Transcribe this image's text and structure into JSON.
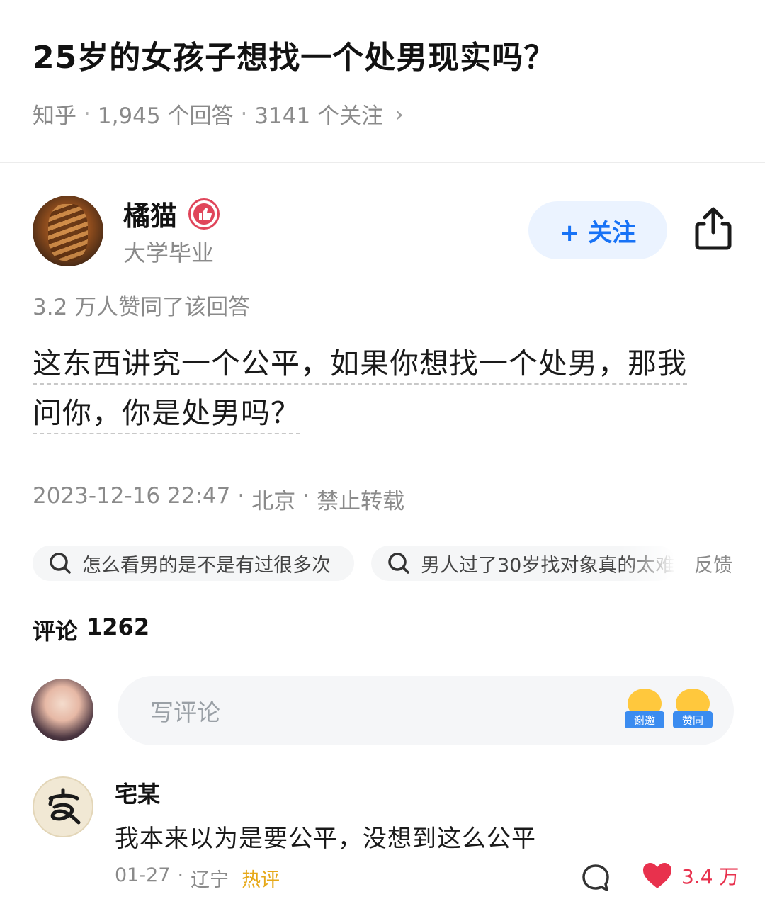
{
  "question": {
    "title": "25岁的女孩子想找一个处男现实吗？",
    "source": "知乎",
    "answers_count": "1,945 个回答",
    "followers_count": "3141 个关注",
    "sep": "·",
    "chevron": "›"
  },
  "author": {
    "name": "橘猫",
    "bio": "大学毕业",
    "follow_label": "+ 关注",
    "avatar_icon": "cat-fur-avatar",
    "badge_icon": "thumbs-up-badge-icon"
  },
  "answer": {
    "upvotes": "3.2 万人赞同了该回答",
    "line1": "这东西讲究一个公平，如果你想找一个处男，那我",
    "line2": "问你，你是处男吗？",
    "datetime": "2023-12-16 22:47",
    "location": "北京",
    "copyright": "禁止转载"
  },
  "related": {
    "items": [
      "怎么看男的是不是有过很多次",
      "男人过了30岁找对象真的太难"
    ],
    "feedback": "反馈"
  },
  "comments": {
    "label": "评论",
    "count": "1262",
    "input_placeholder": "写评论",
    "emoji_thanks": "谢邀",
    "emoji_agree": "赞同",
    "list": [
      {
        "name": "宅某",
        "text": "我本来以为是要公平，没想到这么公平",
        "date": "01-27",
        "location": "辽宁",
        "tag": "热评",
        "likes": "3.4 万"
      }
    ]
  },
  "colors": {
    "accent": "#1772f6",
    "like": "#e8314d",
    "hot": "#e6a817"
  }
}
